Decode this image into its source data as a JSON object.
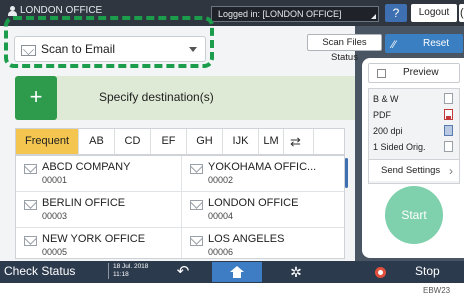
{
  "topbar": {
    "office": "LONDON OFFICE",
    "login_status": "Logged in: [LONDON OFFICE]",
    "help_label": "?",
    "logout_label": "Logout",
    "moon_label": "("
  },
  "function_select": {
    "value": "Scan to Email"
  },
  "scan_files_status_label": "Scan Files Status",
  "reset_label": "Reset",
  "destination": {
    "plus": "+",
    "label": "Specify destination(s)"
  },
  "tabs": [
    "Frequent",
    "AB",
    "CD",
    "EF",
    "GH",
    "IJK",
    "LM"
  ],
  "addresses": [
    {
      "name": "ABCD COMPANY",
      "num": "00001"
    },
    {
      "name": "YOKOHAMA OFFIC...",
      "num": "00002"
    },
    {
      "name": "BERLIN OFFICE",
      "num": "00003"
    },
    {
      "name": "LONDON OFFICE",
      "num": "00004"
    },
    {
      "name": "NEW YORK OFFICE",
      "num": "00005"
    },
    {
      "name": "LOS ANGELES",
      "num": "00006"
    }
  ],
  "right_panel": {
    "preview_label": "Preview",
    "settings": [
      "B & W",
      "PDF",
      "200 dpi",
      "1 Sided Orig."
    ],
    "send_settings_label": "Send Settings",
    "start_label": "Start"
  },
  "bottombar": {
    "check_status": "Check Status",
    "date": "18 Jul. 2018",
    "time": "11:18",
    "stop_label": "Stop"
  },
  "caption": "EBW23",
  "colors": {
    "highlight": "#1b9d4c",
    "accent_blue": "#3a7fc1",
    "tab_active": "#f4c64f",
    "dest_plus": "#2e9a4c",
    "start": "#7fd0ac"
  }
}
